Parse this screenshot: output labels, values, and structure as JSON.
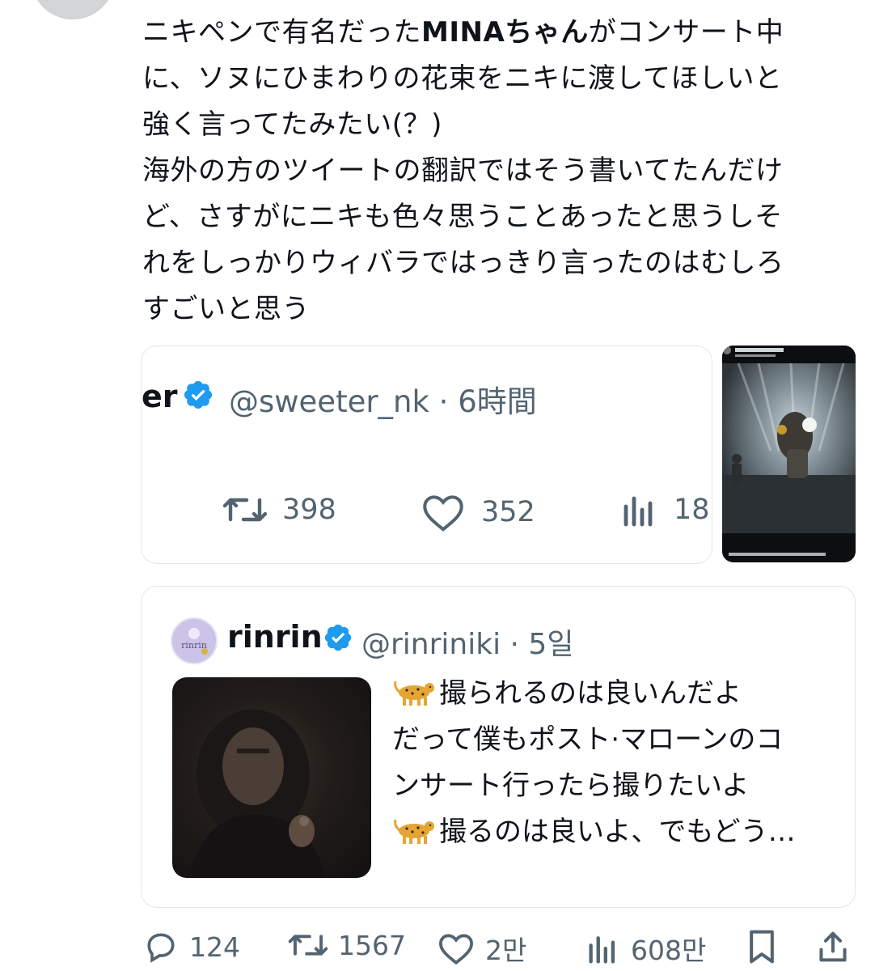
{
  "tweet": {
    "lines": [
      {
        "pre": "ニキペンで有名だった",
        "bold": "MINAちゃん",
        "post": "がコンサート中"
      },
      {
        "pre": "に、ソヌにひまわりの花束をニキに渡してほしいと",
        "bold": "",
        "post": ""
      },
      {
        "pre": "強く言ってたみたい(？)",
        "bold": "",
        "post": ""
      },
      {
        "pre": "海外の方のツイートの翻訳ではそう書いてたんだけ",
        "bold": "",
        "post": ""
      },
      {
        "pre": "ど、さすがにニキも色々思うことあったと思うしそ",
        "bold": "",
        "post": ""
      },
      {
        "pre": "れをしっかりウィバラではっきり言ったのはむしろ",
        "bold": "",
        "post": ""
      },
      {
        "pre": "すごいと思う",
        "bold": "",
        "post": ""
      }
    ]
  },
  "quote_card_a": {
    "name_partial": "er",
    "handle": "@sweeter_nk · 6時間",
    "retweets": "398",
    "likes": "352",
    "views": "18"
  },
  "quote_card_b": {
    "avatar_text": "rinrin",
    "name": "rinrin",
    "handle": "@rinriniki · 5일",
    "lines": [
      {
        "emoji": true,
        "text": "撮られるのは良いんだよ"
      },
      {
        "emoji": false,
        "text": "だって僕もポスト·マローンのコ"
      },
      {
        "emoji": false,
        "text": "ンサート行ったら撮りたいよ"
      },
      {
        "emoji": true,
        "text": "撮るのは良いよ、でもどう…"
      }
    ]
  },
  "actions": {
    "replies": "124",
    "retweets": "1567",
    "likes": "2만",
    "views": "608만"
  },
  "icons": {
    "verified": "verified-badge-icon",
    "reply": "reply-icon",
    "retweet": "retweet-icon",
    "like": "heart-icon",
    "views": "views-icon",
    "bookmark": "bookmark-icon",
    "share": "share-icon"
  },
  "colors": {
    "text": "#0f1419",
    "secondary": "#536471",
    "verified": "#1d9bf0",
    "border": "#e3e6e8"
  }
}
